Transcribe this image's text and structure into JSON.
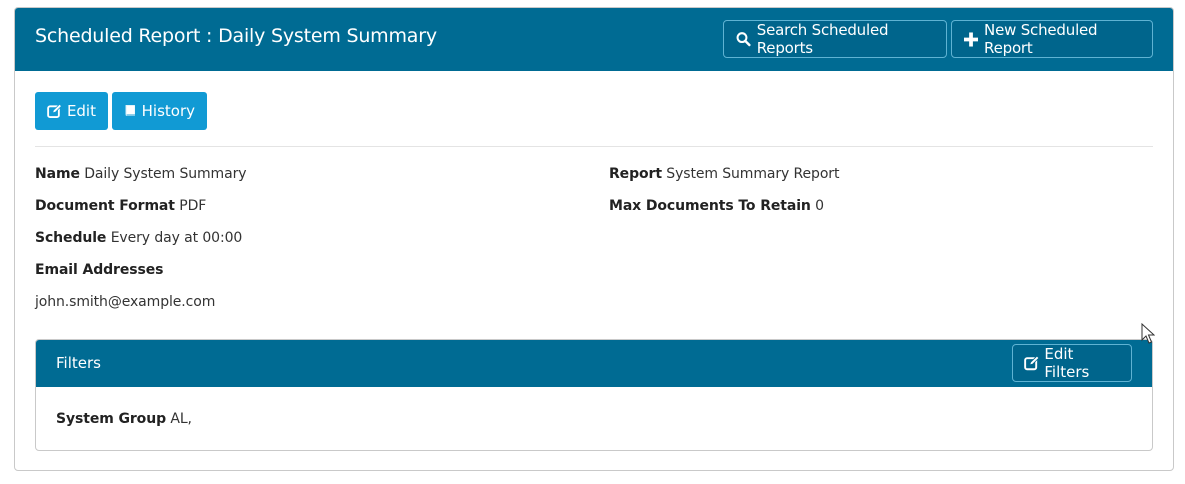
{
  "header": {
    "title": "Scheduled Report : Daily System Summary",
    "search_label": "Search Scheduled Reports",
    "new_label": "New Scheduled Report"
  },
  "toolbar": {
    "edit_label": "Edit",
    "history_label": "History"
  },
  "details": {
    "name_label": "Name",
    "name_value": "Daily System Summary",
    "format_label": "Document Format",
    "format_value": "PDF",
    "schedule_label": "Schedule",
    "schedule_value": "Every day at 00:00",
    "email_label": "Email Addresses",
    "email_value": "john.smith@example.com",
    "report_label": "Report",
    "report_value": "System Summary Report",
    "retain_label": "Max Documents To Retain",
    "retain_value": "0"
  },
  "filters": {
    "title": "Filters",
    "edit_label": "Edit Filters",
    "group_label": "System Group",
    "group_value": "AL,"
  },
  "colors": {
    "header_bg": "#006b93",
    "button_blue": "#119ad4"
  }
}
